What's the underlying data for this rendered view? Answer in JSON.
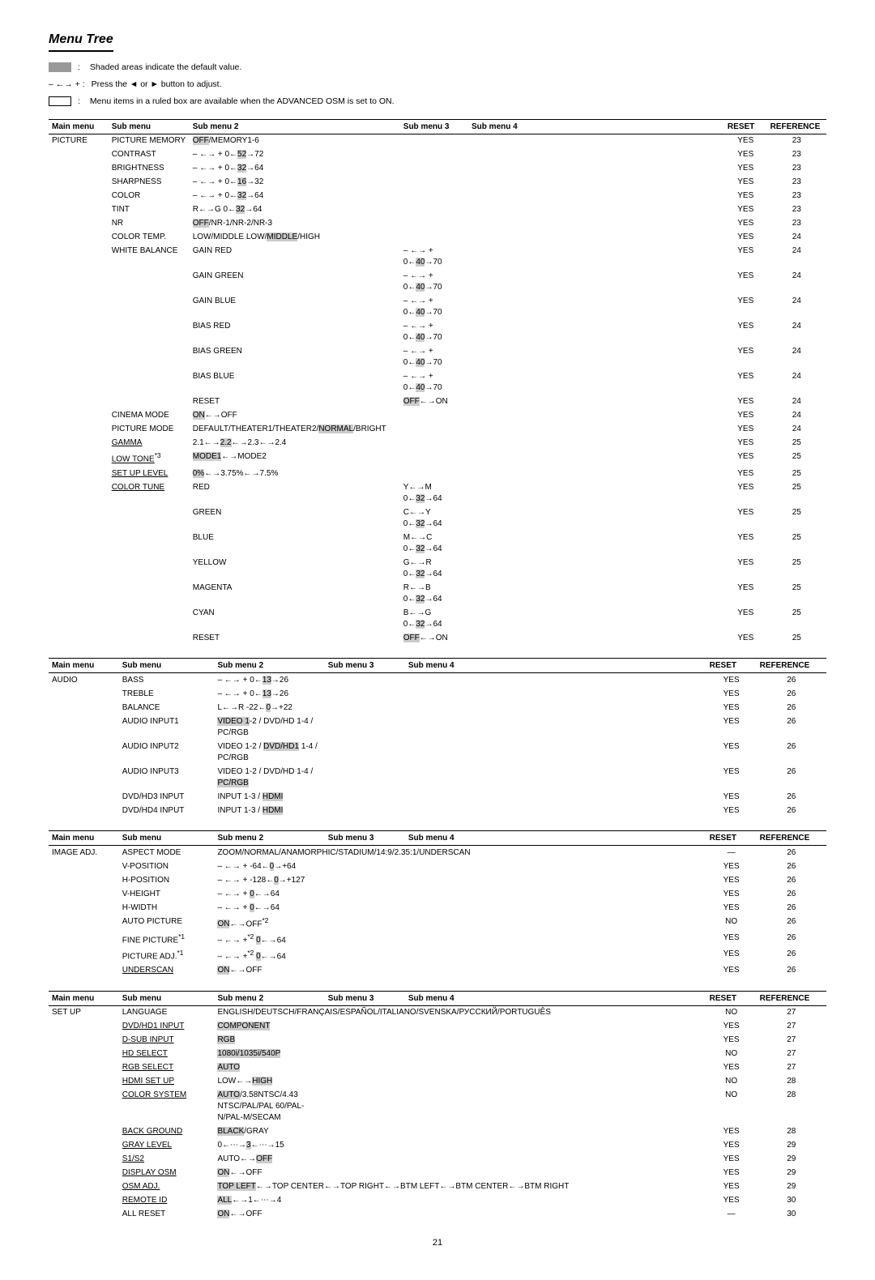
{
  "title": "Menu Tree",
  "legend": {
    "shade_label": "Shaded areas indicate the default value.",
    "arrow_symbol": "– ←→ + :",
    "arrow_label": "Press the ◄ or ► button to adjust.",
    "ruled_label": "Menu items in a ruled box are available when the ADVANCED OSM is set to ON."
  },
  "tables": [
    {
      "id": "table1",
      "headers": [
        "Main menu",
        "Sub menu",
        "Sub menu 2",
        "Sub menu 3",
        "Sub menu 4",
        "RESET",
        "REFERENCE"
      ],
      "main_menu": "PICTURE",
      "rows": [
        {
          "sub1": "PICTURE MEMORY",
          "sub2": "OFF/MEMORY1-6",
          "sub3": "",
          "sub4": "",
          "reset": "YES",
          "ref": "23",
          "sub2_style": "highlight"
        },
        {
          "sub1": "CONTRAST",
          "sub2": "– ←→ + 0←52→72",
          "sub3": "",
          "sub4": "",
          "reset": "YES",
          "ref": "23",
          "sub2_highlight": "52"
        },
        {
          "sub1": "BRIGHTNESS",
          "sub2": "– ←→ + 0←32→64",
          "sub3": "",
          "sub4": "",
          "reset": "YES",
          "ref": "23",
          "sub2_highlight": "32"
        },
        {
          "sub1": "SHARPNESS",
          "sub2": "– ←→ + 0←16→32",
          "sub3": "",
          "sub4": "",
          "reset": "YES",
          "ref": "23",
          "sub2_highlight": "16"
        },
        {
          "sub1": "COLOR",
          "sub2": "– ←→ + 0←32→64",
          "sub3": "",
          "sub4": "",
          "reset": "YES",
          "ref": "23",
          "sub2_highlight": "32"
        },
        {
          "sub1": "TINT",
          "sub2": "R←→G  0←32→64",
          "sub3": "",
          "sub4": "",
          "reset": "YES",
          "ref": "23",
          "sub2_highlight": "32"
        },
        {
          "sub1": "NR",
          "sub2": "OFF/NR-1/NR-2/NR-3",
          "sub3": "",
          "sub4": "",
          "reset": "YES",
          "ref": "23",
          "sub2_style": "highlight"
        },
        {
          "sub1": "COLOR TEMP.",
          "sub2": "LOW/MIDDLE LOW/MIDDLE/HIGH",
          "sub3": "",
          "sub4": "",
          "reset": "YES",
          "ref": "24",
          "sub2_highlight": "MIDDLE"
        },
        {
          "sub1": "WHITE BALANCE",
          "sub2": "GAIN RED",
          "sub3": "– ←→ + 0←40→70",
          "sub4": "",
          "reset": "YES",
          "ref": "24",
          "sub3_highlight": "40"
        },
        {
          "sub1": "",
          "sub2": "GAIN GREEN",
          "sub3": "– ←→ + 0←40→70",
          "sub4": "",
          "reset": "YES",
          "ref": "24",
          "sub3_highlight": "40"
        },
        {
          "sub1": "",
          "sub2": "GAIN BLUE",
          "sub3": "– ←→ + 0←40→70",
          "sub4": "",
          "reset": "YES",
          "ref": "24",
          "sub3_highlight": "40"
        },
        {
          "sub1": "",
          "sub2": "BIAS RED",
          "sub3": "– ←→ + 0←40→70",
          "sub4": "",
          "reset": "YES",
          "ref": "24",
          "sub3_highlight": "40"
        },
        {
          "sub1": "",
          "sub2": "BIAS GREEN",
          "sub3": "– ←→ + 0←40→70",
          "sub4": "",
          "reset": "YES",
          "ref": "24",
          "sub3_highlight": "40"
        },
        {
          "sub1": "",
          "sub2": "BIAS BLUE",
          "sub3": "– ←→ + 0←40→70",
          "sub4": "",
          "reset": "YES",
          "ref": "24",
          "sub3_highlight": "40"
        },
        {
          "sub1": "",
          "sub2": "RESET",
          "sub3": "OFF←→ON",
          "sub4": "",
          "reset": "YES",
          "ref": "24",
          "sub3_style": "highlight"
        },
        {
          "sub1": "CINEMA MODE",
          "sub2": "ON←→OFF",
          "sub3": "",
          "sub4": "",
          "reset": "YES",
          "ref": "24",
          "sub2_style": "highlight"
        },
        {
          "sub1": "PICTURE MODE",
          "sub2": "DEFAULT/THEATER1/THEATER2/NORMAL/BRIGHT",
          "sub3": "",
          "sub4": "",
          "reset": "YES",
          "ref": "24",
          "sub2_highlight": "NORMAL"
        },
        {
          "sub1": "GAMMA",
          "sub2": "2.1←→2.2←→2.3←→2.4",
          "sub3": "",
          "sub4": "",
          "reset": "YES",
          "ref": "25",
          "sub1_ruled": true,
          "sub2_highlight": "2.2"
        },
        {
          "sub1": "LOW TONE",
          "sub2": "MODE1←→MODE2",
          "sub3": "",
          "sub4": "",
          "reset": "YES",
          "ref": "25",
          "sub1_ruled": true,
          "sub1_sup": "*3",
          "sub2_style": "highlight"
        },
        {
          "sub1": "SET UP LEVEL",
          "sub2": "0%←→3.75%←→7.5%",
          "sub3": "",
          "sub4": "",
          "reset": "YES",
          "ref": "25",
          "sub1_ruled": true,
          "sub2_highlight": "0%"
        },
        {
          "sub1": "COLOR TUNE",
          "sub2": "RED",
          "sub3": "Y←→M  0←32→64",
          "sub4": "",
          "reset": "YES",
          "ref": "25",
          "sub1_ruled": true,
          "sub3_highlight": "32"
        },
        {
          "sub1": "",
          "sub2": "GREEN",
          "sub3": "C←→Y  0←32→64",
          "sub4": "",
          "reset": "YES",
          "ref": "25",
          "sub3_highlight": "32"
        },
        {
          "sub1": "",
          "sub2": "BLUE",
          "sub3": "M←→C  0←32→64",
          "sub4": "",
          "reset": "YES",
          "ref": "25",
          "sub3_highlight": "32"
        },
        {
          "sub1": "",
          "sub2": "YELLOW",
          "sub3": "G←→R  0←32→64",
          "sub4": "",
          "reset": "YES",
          "ref": "25",
          "sub3_highlight": "32"
        },
        {
          "sub1": "",
          "sub2": "MAGENTA",
          "sub3": "R←→B  0←32→64",
          "sub4": "",
          "reset": "YES",
          "ref": "25",
          "sub3_highlight": "32"
        },
        {
          "sub1": "",
          "sub2": "CYAN",
          "sub3": "B←→G  0←32→64",
          "sub4": "",
          "reset": "YES",
          "ref": "25",
          "sub3_highlight": "32"
        },
        {
          "sub1": "",
          "sub2": "RESET",
          "sub3": "OFF←→ON",
          "sub4": "",
          "reset": "YES",
          "ref": "25",
          "sub3_style": "highlight"
        }
      ]
    },
    {
      "id": "table2",
      "main_menu": "AUDIO",
      "rows": [
        {
          "sub1": "BASS",
          "sub2": "– ←→ + 0←13→26",
          "sub3": "",
          "sub4": "",
          "reset": "YES",
          "ref": "26",
          "sub2_highlight": "13"
        },
        {
          "sub1": "TREBLE",
          "sub2": "– ←→ + 0←13→26",
          "sub3": "",
          "sub4": "",
          "reset": "YES",
          "ref": "26",
          "sub2_highlight": "13"
        },
        {
          "sub1": "BALANCE",
          "sub2": "L←→R  -22←0→+22",
          "sub3": "",
          "sub4": "",
          "reset": "YES",
          "ref": "26",
          "sub2_highlight": "0"
        },
        {
          "sub1": "AUDIO INPUT1",
          "sub2": "VIDEO 1-2 / DVD/HD 1-4 / PC/RGB",
          "sub3": "",
          "sub4": "",
          "reset": "YES",
          "ref": "26",
          "sub2_highlight": "VIDEO 1"
        },
        {
          "sub1": "AUDIO INPUT2",
          "sub2": "VIDEO 1-2 / DVD/HD 1-4 / PC/RGB",
          "sub3": "",
          "sub4": "",
          "reset": "YES",
          "ref": "26",
          "sub2_highlight": "DVD/HD1"
        },
        {
          "sub1": "AUDIO INPUT3",
          "sub2": "VIDEO 1-2 / DVD/HD 1-4 / PC/RGB",
          "sub3": "",
          "sub4": "",
          "reset": "YES",
          "ref": "26",
          "sub2_highlight": "PC/RGB"
        },
        {
          "sub1": "DVD/HD3 INPUT",
          "sub2": "INPUT 1-3 / HDMI",
          "sub3": "",
          "sub4": "",
          "reset": "YES",
          "ref": "26",
          "sub2_highlight": "HDMI"
        },
        {
          "sub1": "DVD/HD4 INPUT",
          "sub2": "INPUT 1-3 / HDMI",
          "sub3": "",
          "sub4": "",
          "reset": "YES",
          "ref": "26",
          "sub2_highlight": "HDMI"
        }
      ]
    },
    {
      "id": "table3",
      "main_menu": "IMAGE ADJ.",
      "rows": [
        {
          "sub1": "ASPECT MODE",
          "sub2": "ZOOM/NORMAL/ANAMORPHIC/STADIUM/14:9/2.35:1/UNDERSCAN",
          "sub3": "",
          "sub4": "",
          "reset": "—",
          "ref": "26"
        },
        {
          "sub1": "V-POSITION",
          "sub2": "– ←→ +  -64←0→+64",
          "sub3": "",
          "sub4": "",
          "reset": "YES",
          "ref": "26",
          "sub2_highlight": "0"
        },
        {
          "sub1": "H-POSITION",
          "sub2": "– ←→ +  -128←0→+127",
          "sub3": "",
          "sub4": "",
          "reset": "YES",
          "ref": "26",
          "sub2_highlight": "0"
        },
        {
          "sub1": "V-HEIGHT",
          "sub2": "– ←→ +  0←→64",
          "sub3": "",
          "sub4": "",
          "reset": "YES",
          "ref": "26",
          "sub2_highlight": "0"
        },
        {
          "sub1": "H-WIDTH",
          "sub2": "– ←→ +  0←→64",
          "sub3": "",
          "sub4": "",
          "reset": "YES",
          "ref": "26",
          "sub2_highlight": "0"
        },
        {
          "sub1": "AUTO PICTURE",
          "sub2": "ON←→OFF*2",
          "sub3": "",
          "sub4": "",
          "reset": "NO",
          "ref": "26",
          "sub2_style": "highlight"
        },
        {
          "sub1": "FINE PICTURE*1",
          "sub2": "– ←→ +*2 0←→64",
          "sub3": "",
          "sub4": "",
          "reset": "YES",
          "ref": "26",
          "sub2_highlight": "0"
        },
        {
          "sub1": "PICTURE ADJ.*1",
          "sub2": "– ←→ +*2 0←→64",
          "sub3": "",
          "sub4": "",
          "reset": "YES",
          "ref": "26",
          "sub2_highlight": "0"
        },
        {
          "sub1": "UNDERSCAN",
          "sub2": "ON←→OFF",
          "sub3": "",
          "sub4": "",
          "reset": "YES",
          "ref": "26",
          "sub1_ruled": true,
          "sub2_style": "highlight"
        }
      ]
    },
    {
      "id": "table4",
      "main_menu": "SET UP",
      "rows": [
        {
          "sub1": "LANGUAGE",
          "sub2": "ENGLISH/DEUTSCH/FRANÇAIS/ESPAÑOL/ITALIANO/SVENSKA/РУССКИЙ/PORTUGUÊS",
          "sub3": "",
          "sub4": "",
          "reset": "NO",
          "ref": "27"
        },
        {
          "sub1": "DVD/HD1 INPUT",
          "sub2": "COMPONENT",
          "sub3": "",
          "sub4": "",
          "reset": "YES",
          "ref": "27",
          "sub1_ruled": true,
          "sub2_style": "highlight"
        },
        {
          "sub1": "D-SUB INPUT",
          "sub2": "RGB",
          "sub3": "",
          "sub4": "",
          "reset": "YES",
          "ref": "27",
          "sub1_ruled": true,
          "sub2_style": "highlight"
        },
        {
          "sub1": "HD SELECT",
          "sub2": "1080i/1035i/540P",
          "sub3": "",
          "sub4": "",
          "reset": "NO",
          "ref": "27",
          "sub1_ruled": true,
          "sub2_style": "highlight"
        },
        {
          "sub1": "RGB SELECT",
          "sub2": "AUTO",
          "sub3": "",
          "sub4": "",
          "reset": "YES",
          "ref": "27",
          "sub1_ruled": true,
          "sub2_style": "highlight"
        },
        {
          "sub1": "HDMI SET UP",
          "sub2": "LOW←→HIGH",
          "sub3": "",
          "sub4": "",
          "reset": "NO",
          "ref": "28",
          "sub1_ruled": true,
          "sub2_highlight": "HIGH"
        },
        {
          "sub1": "COLOR SYSTEM",
          "sub2": "AUTO/3.58NTSC/4.43 NTSC/PAL/PAL 60/PAL-N/PAL-M/SECAM",
          "sub3": "",
          "sub4": "",
          "reset": "NO",
          "ref": "28",
          "sub1_ruled": true,
          "sub2_highlight": "AUTO"
        },
        {
          "sub1": "BACK GROUND",
          "sub2": "BLACK/GRAY",
          "sub3": "",
          "sub4": "",
          "reset": "YES",
          "ref": "28",
          "sub1_ruled": true,
          "sub2_style": "highlight"
        },
        {
          "sub1": "GRAY LEVEL",
          "sub2": "0←⋯→3←⋯→15",
          "sub3": "",
          "sub4": "",
          "reset": "YES",
          "ref": "29",
          "sub1_ruled": true,
          "sub2_highlight": "3"
        },
        {
          "sub1": "S1/S2",
          "sub2": "AUTO←→OFF",
          "sub3": "",
          "sub4": "",
          "reset": "YES",
          "ref": "29",
          "sub1_ruled": true,
          "sub2_highlight": "OFF"
        },
        {
          "sub1": "DISPLAY OSM",
          "sub2": "ON←→OFF",
          "sub3": "",
          "sub4": "",
          "reset": "YES",
          "ref": "29",
          "sub1_ruled": true,
          "sub2_style": "highlight"
        },
        {
          "sub1": "OSM ADJ.",
          "sub2": "TOP LEFT←→TOP CENTER←→TOP RIGHT←→BTM LEFT←→BTM CENTER←→BTM RIGHT",
          "sub3": "",
          "sub4": "",
          "reset": "YES",
          "ref": "29",
          "sub1_ruled": true,
          "sub2_highlight": "TOP LEFT"
        },
        {
          "sub1": "REMOTE ID",
          "sub2": "ALL←→1←⋯→4",
          "sub3": "",
          "sub4": "",
          "reset": "YES",
          "ref": "30",
          "sub1_ruled": true,
          "sub2_highlight": "ALL"
        },
        {
          "sub1": "ALL RESET",
          "sub2": "ON←→OFF",
          "sub3": "",
          "sub4": "",
          "reset": "—",
          "ref": "30",
          "sub2_style": "highlight"
        }
      ]
    }
  ],
  "page_number": "21"
}
